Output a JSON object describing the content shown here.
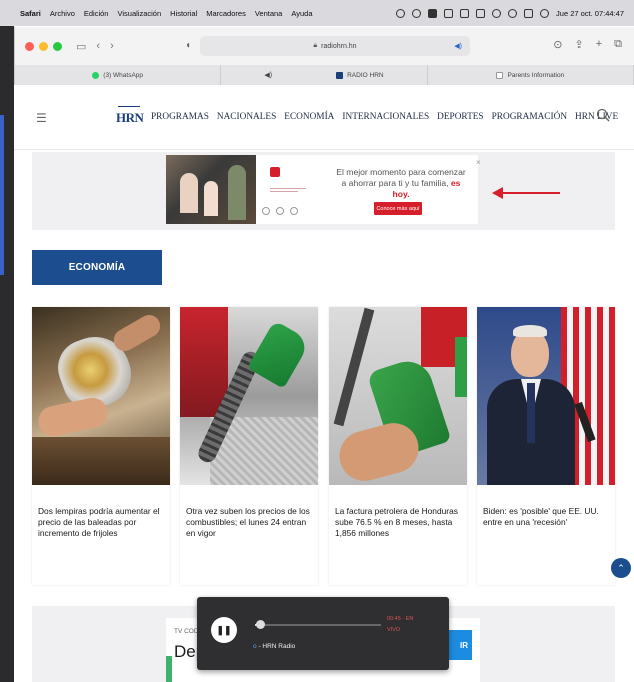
{
  "menubar": {
    "app": "Safari",
    "items": [
      "Archivo",
      "Edición",
      "Visualización",
      "Historial",
      "Marcadores",
      "Ventana",
      "Ayuda"
    ],
    "datetime": "Jue 27 oct. 07:44:47"
  },
  "browser": {
    "url": "radiohrn.hn",
    "tabs": [
      {
        "label": "(3) WhatsApp"
      },
      {
        "label": "RADIO HRN"
      },
      {
        "label": "Parents Information"
      }
    ]
  },
  "site": {
    "logo": "HRN",
    "nav": [
      "PROGRAMAS",
      "NACIONALES",
      "ECONOMÍA",
      "INTERNACIONALES",
      "DEPORTES",
      "PROGRAMACIÓN",
      "HRN LIVE"
    ]
  },
  "ad": {
    "text_before": "El mejor momento para comenzar a ahorrar para ti y tu familia,",
    "text_highlight": "es hoy.",
    "button": "Conoce más aquí",
    "close": "×"
  },
  "section": {
    "title": "ECONOMÍA"
  },
  "articles": [
    {
      "title": "Dos lempiras podría aumentar el precio de las baleadas por incremento de frijoles"
    },
    {
      "title": "Otra vez suben los precios de los combustibles; el lunes 24 entran en vigor"
    },
    {
      "title": "La factura petrolera de Honduras sube 76.5 % en 8 meses, hasta 1,856 millones"
    },
    {
      "title": "Biden: es 'posible' que EE. UU. entre en una 'recesión'"
    }
  ],
  "bottom_ad": {
    "label": "TV COD",
    "headline": "Dep",
    "cta": "IR"
  },
  "player": {
    "time": "00:45 - EN",
    "live": "VIVO",
    "station_prefix": "o",
    "station": "- HRN Radio",
    "progress_fraction": 0.04
  },
  "colors": {
    "brand_blue": "#1c4d8f",
    "accent_red": "#d51f2a"
  }
}
